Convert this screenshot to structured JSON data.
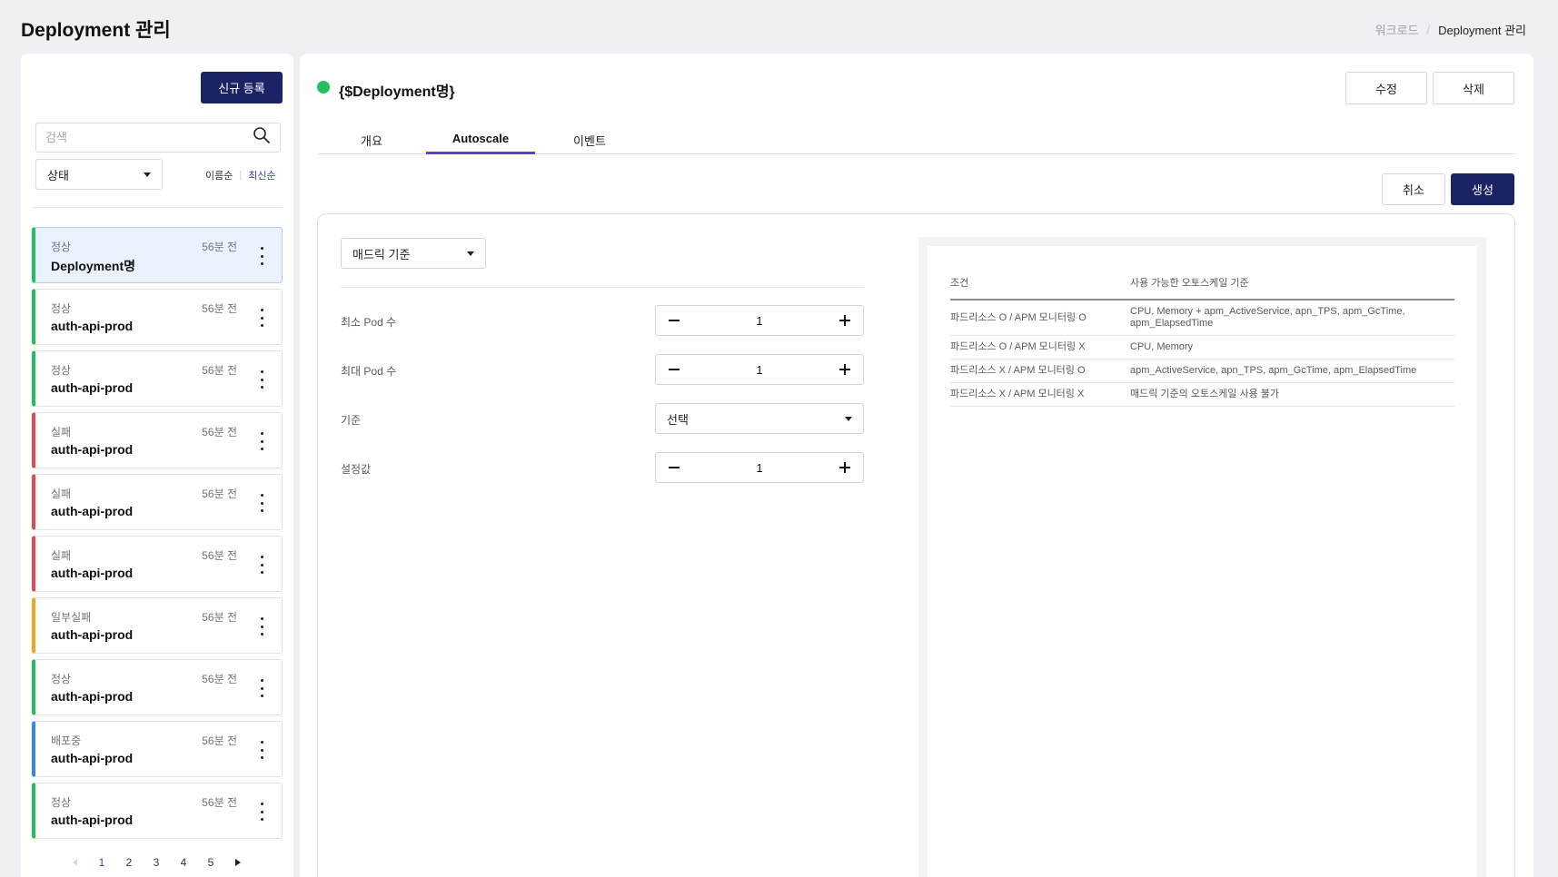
{
  "header": {
    "title": "Deployment 관리",
    "breadcrumb": {
      "parent": "워크로드",
      "separator": "/",
      "current": "Deployment 관리"
    }
  },
  "sidebar": {
    "new_button": "신규 등록",
    "search_placeholder": "검색",
    "status_filter": "상태",
    "sort_by_name": "이름순",
    "sort_separator": "|",
    "sort_latest": "최신순",
    "items": [
      {
        "status": "정상",
        "time": "56분 전",
        "name": "Deployment명",
        "color": "#23c05b",
        "selected": true
      },
      {
        "status": "정상",
        "time": "56분 전",
        "name": "auth-api-prod",
        "color": "#23c05b"
      },
      {
        "status": "정상",
        "time": "56분 전",
        "name": "auth-api-prod",
        "color": "#23c05b"
      },
      {
        "status": "실패",
        "time": "56분 전",
        "name": "auth-api-prod",
        "color": "#e5484d"
      },
      {
        "status": "실패",
        "time": "56분 전",
        "name": "auth-api-prod",
        "color": "#e5484d"
      },
      {
        "status": "실패",
        "time": "56분 전",
        "name": "auth-api-prod",
        "color": "#e5484d"
      },
      {
        "status": "일부실패",
        "time": "56분 전",
        "name": "auth-api-prod",
        "color": "#f5a524"
      },
      {
        "status": "정상",
        "time": "56분 전",
        "name": "auth-api-prod",
        "color": "#23c05b"
      },
      {
        "status": "배포중",
        "time": "56분 전",
        "name": "auth-api-prod",
        "color": "#3b82f6"
      },
      {
        "status": "정상",
        "time": "56분 전",
        "name": "auth-api-prod",
        "color": "#23c05b"
      }
    ],
    "pagination": {
      "pages": [
        "1",
        "2",
        "3",
        "4",
        "5"
      ],
      "current": "1"
    }
  },
  "detail": {
    "title": "{$Deployment명}",
    "status_color": "#23c05b",
    "edit_button": "수정",
    "delete_button": "삭제",
    "tabs": [
      {
        "label": "개요",
        "active": false
      },
      {
        "label": "Autoscale",
        "active": true
      },
      {
        "label": "이벤트",
        "active": false
      }
    ],
    "cancel_button": "취소",
    "create_button": "생성"
  },
  "form": {
    "metric_select": "매드릭 기준",
    "min_pods": {
      "label": "최소 Pod 수",
      "value": "1"
    },
    "max_pods": {
      "label": "최대 Pod 수",
      "value": "1"
    },
    "criteria": {
      "label": "기준",
      "value": "선택"
    },
    "setting": {
      "label": "설정값",
      "value": "1"
    }
  },
  "info_table": {
    "headers": [
      "조건",
      "사용 가능한 오토스케일 기준"
    ],
    "rows": [
      [
        "파드리소스 O / APM 모니터링 O",
        "CPU, Memory + apm_ActiveService, apn_TPS, apm_GcTime, apm_ElapsedTime"
      ],
      [
        "파드리소스 O / APM 모니터링 X",
        "CPU, Memory"
      ],
      [
        "파드리소스 X / APM 모니터링 O",
        "apm_ActiveService, apn_TPS, apm_GcTime, apm_ElapsedTime"
      ],
      [
        "파드리소스 X / APM 모니터링 X",
        "매드릭 기준의 오토스케일 사용 불가"
      ]
    ]
  },
  "colors": {
    "primary": "#1b2366",
    "accent": "#5b3fd9",
    "link": "#3343c8"
  },
  "icons": {
    "search": "search-icon",
    "more": "kebab-icon",
    "dropdown": "caret-down-icon"
  }
}
